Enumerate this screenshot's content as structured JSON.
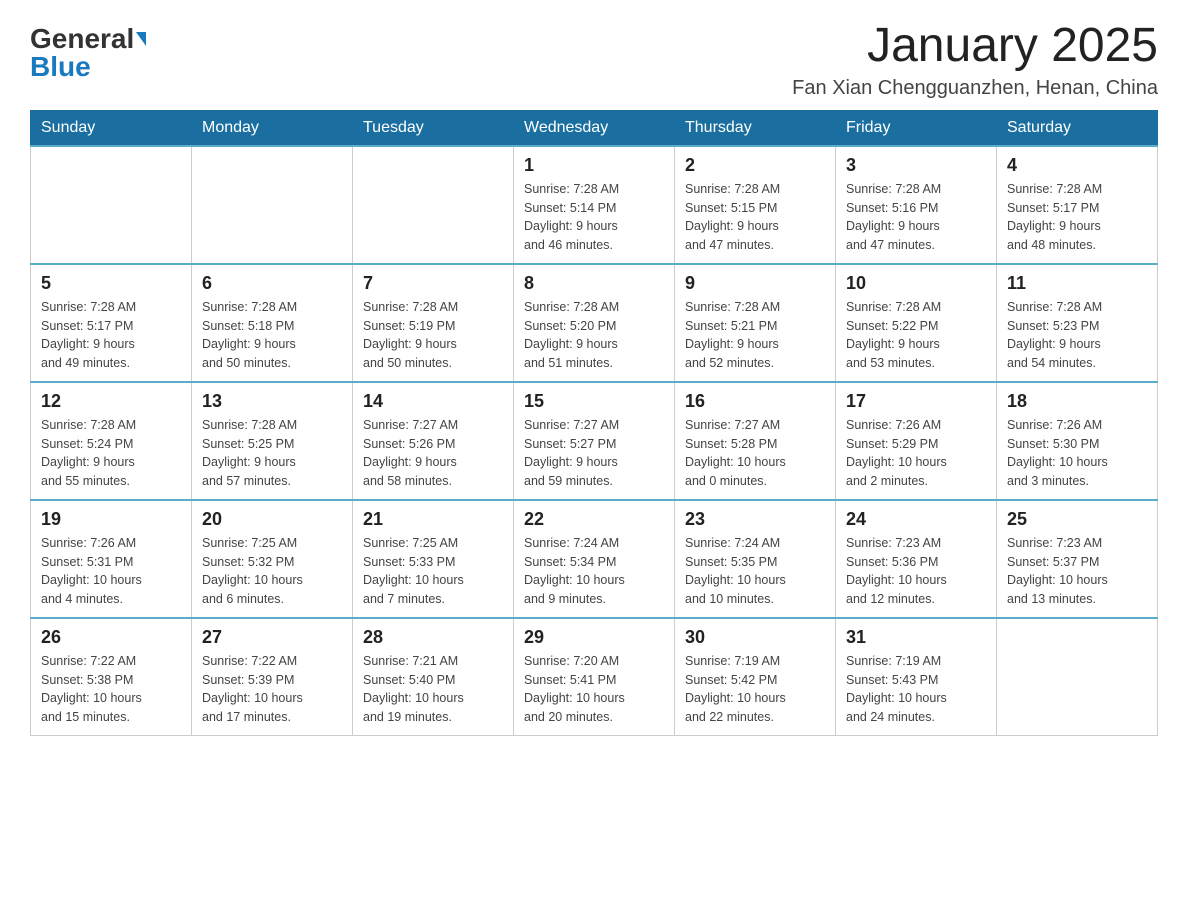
{
  "header": {
    "logo_general": "General",
    "logo_blue": "Blue",
    "title": "January 2025",
    "subtitle": "Fan Xian Chengguanzhen, Henan, China"
  },
  "days_of_week": [
    "Sunday",
    "Monday",
    "Tuesday",
    "Wednesday",
    "Thursday",
    "Friday",
    "Saturday"
  ],
  "weeks": [
    [
      {
        "number": "",
        "info": ""
      },
      {
        "number": "",
        "info": ""
      },
      {
        "number": "",
        "info": ""
      },
      {
        "number": "1",
        "info": "Sunrise: 7:28 AM\nSunset: 5:14 PM\nDaylight: 9 hours\nand 46 minutes."
      },
      {
        "number": "2",
        "info": "Sunrise: 7:28 AM\nSunset: 5:15 PM\nDaylight: 9 hours\nand 47 minutes."
      },
      {
        "number": "3",
        "info": "Sunrise: 7:28 AM\nSunset: 5:16 PM\nDaylight: 9 hours\nand 47 minutes."
      },
      {
        "number": "4",
        "info": "Sunrise: 7:28 AM\nSunset: 5:17 PM\nDaylight: 9 hours\nand 48 minutes."
      }
    ],
    [
      {
        "number": "5",
        "info": "Sunrise: 7:28 AM\nSunset: 5:17 PM\nDaylight: 9 hours\nand 49 minutes."
      },
      {
        "number": "6",
        "info": "Sunrise: 7:28 AM\nSunset: 5:18 PM\nDaylight: 9 hours\nand 50 minutes."
      },
      {
        "number": "7",
        "info": "Sunrise: 7:28 AM\nSunset: 5:19 PM\nDaylight: 9 hours\nand 50 minutes."
      },
      {
        "number": "8",
        "info": "Sunrise: 7:28 AM\nSunset: 5:20 PM\nDaylight: 9 hours\nand 51 minutes."
      },
      {
        "number": "9",
        "info": "Sunrise: 7:28 AM\nSunset: 5:21 PM\nDaylight: 9 hours\nand 52 minutes."
      },
      {
        "number": "10",
        "info": "Sunrise: 7:28 AM\nSunset: 5:22 PM\nDaylight: 9 hours\nand 53 minutes."
      },
      {
        "number": "11",
        "info": "Sunrise: 7:28 AM\nSunset: 5:23 PM\nDaylight: 9 hours\nand 54 minutes."
      }
    ],
    [
      {
        "number": "12",
        "info": "Sunrise: 7:28 AM\nSunset: 5:24 PM\nDaylight: 9 hours\nand 55 minutes."
      },
      {
        "number": "13",
        "info": "Sunrise: 7:28 AM\nSunset: 5:25 PM\nDaylight: 9 hours\nand 57 minutes."
      },
      {
        "number": "14",
        "info": "Sunrise: 7:27 AM\nSunset: 5:26 PM\nDaylight: 9 hours\nand 58 minutes."
      },
      {
        "number": "15",
        "info": "Sunrise: 7:27 AM\nSunset: 5:27 PM\nDaylight: 9 hours\nand 59 minutes."
      },
      {
        "number": "16",
        "info": "Sunrise: 7:27 AM\nSunset: 5:28 PM\nDaylight: 10 hours\nand 0 minutes."
      },
      {
        "number": "17",
        "info": "Sunrise: 7:26 AM\nSunset: 5:29 PM\nDaylight: 10 hours\nand 2 minutes."
      },
      {
        "number": "18",
        "info": "Sunrise: 7:26 AM\nSunset: 5:30 PM\nDaylight: 10 hours\nand 3 minutes."
      }
    ],
    [
      {
        "number": "19",
        "info": "Sunrise: 7:26 AM\nSunset: 5:31 PM\nDaylight: 10 hours\nand 4 minutes."
      },
      {
        "number": "20",
        "info": "Sunrise: 7:25 AM\nSunset: 5:32 PM\nDaylight: 10 hours\nand 6 minutes."
      },
      {
        "number": "21",
        "info": "Sunrise: 7:25 AM\nSunset: 5:33 PM\nDaylight: 10 hours\nand 7 minutes."
      },
      {
        "number": "22",
        "info": "Sunrise: 7:24 AM\nSunset: 5:34 PM\nDaylight: 10 hours\nand 9 minutes."
      },
      {
        "number": "23",
        "info": "Sunrise: 7:24 AM\nSunset: 5:35 PM\nDaylight: 10 hours\nand 10 minutes."
      },
      {
        "number": "24",
        "info": "Sunrise: 7:23 AM\nSunset: 5:36 PM\nDaylight: 10 hours\nand 12 minutes."
      },
      {
        "number": "25",
        "info": "Sunrise: 7:23 AM\nSunset: 5:37 PM\nDaylight: 10 hours\nand 13 minutes."
      }
    ],
    [
      {
        "number": "26",
        "info": "Sunrise: 7:22 AM\nSunset: 5:38 PM\nDaylight: 10 hours\nand 15 minutes."
      },
      {
        "number": "27",
        "info": "Sunrise: 7:22 AM\nSunset: 5:39 PM\nDaylight: 10 hours\nand 17 minutes."
      },
      {
        "number": "28",
        "info": "Sunrise: 7:21 AM\nSunset: 5:40 PM\nDaylight: 10 hours\nand 19 minutes."
      },
      {
        "number": "29",
        "info": "Sunrise: 7:20 AM\nSunset: 5:41 PM\nDaylight: 10 hours\nand 20 minutes."
      },
      {
        "number": "30",
        "info": "Sunrise: 7:19 AM\nSunset: 5:42 PM\nDaylight: 10 hours\nand 22 minutes."
      },
      {
        "number": "31",
        "info": "Sunrise: 7:19 AM\nSunset: 5:43 PM\nDaylight: 10 hours\nand 24 minutes."
      },
      {
        "number": "",
        "info": ""
      }
    ]
  ],
  "colors": {
    "header_bg": "#1a6fa0",
    "header_text": "#ffffff",
    "accent": "#1a7abf"
  }
}
